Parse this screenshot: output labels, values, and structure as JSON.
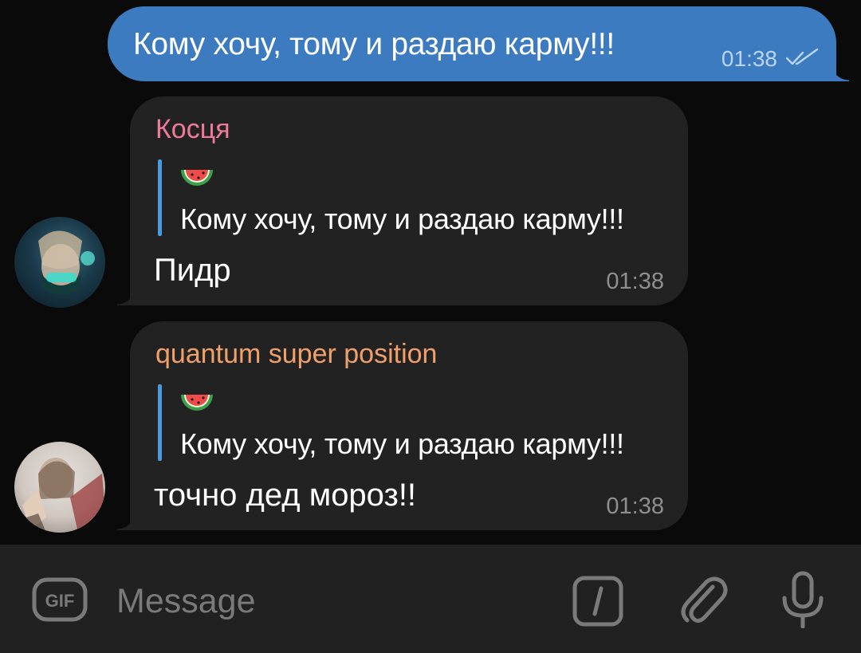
{
  "outgoing": {
    "text": "Кому хочу, тому и раздаю карму!!!",
    "time": "01:38",
    "status_icon": "double-check-icon"
  },
  "messages": [
    {
      "sender": "Косця",
      "sender_color": "#f07a9a",
      "reply_emoji": "🍉",
      "reply_text": "Кому хочу, тому и раздаю карму!!!",
      "text": "Пидр",
      "time": "01:38"
    },
    {
      "sender": "quantum super position",
      "sender_color": "#f2a06a",
      "reply_emoji": "🍉",
      "reply_text": "Кому хочу, тому и раздаю карму!!!",
      "text": "точно дед мороз!!",
      "time": "01:38"
    }
  ],
  "input": {
    "placeholder": "Message",
    "gif_label": "GIF"
  },
  "colors": {
    "outgoing_bubble": "#3d7bc0",
    "incoming_bubble": "#222222",
    "reply_bar": "#4a9ae0",
    "background": "#0a0a0a",
    "input_bar": "#212121"
  }
}
